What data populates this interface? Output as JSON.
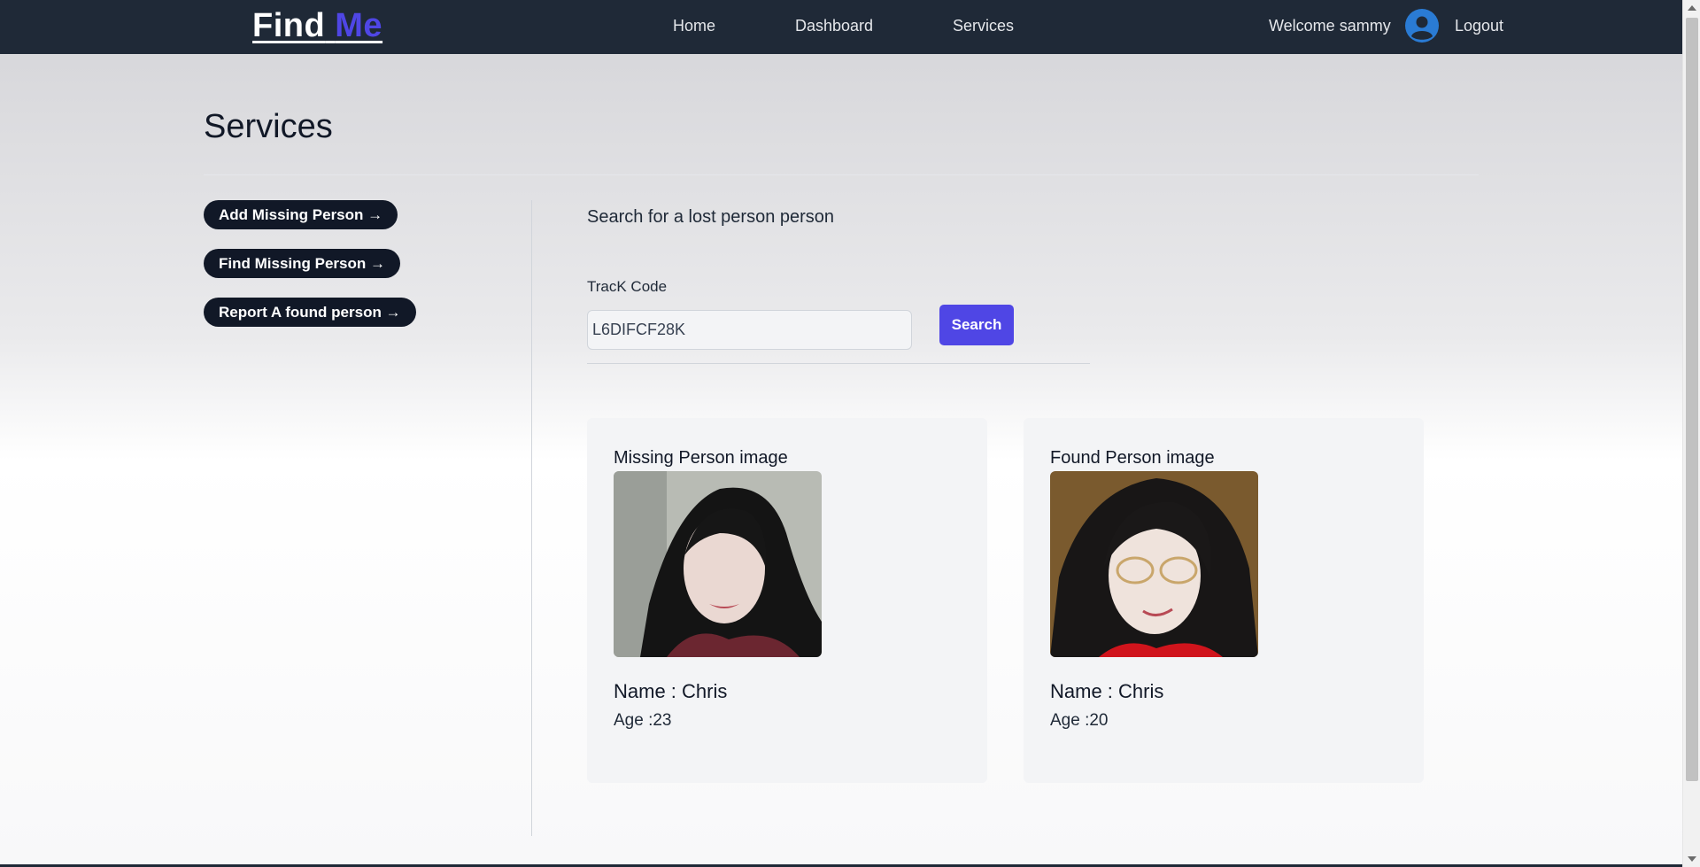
{
  "navbar": {
    "logo_part1": "Find",
    "logo_part2": "Me",
    "links": [
      "Home",
      "Dashboard",
      "Services"
    ],
    "welcome": "Welcome sammy",
    "avatar_icon": "user-circle-icon",
    "logout": "Logout"
  },
  "page": {
    "title": "Services"
  },
  "sidebar": {
    "buttons": [
      "Add Missing Person →",
      "Find Missing Person →",
      "Report A found person →"
    ]
  },
  "search": {
    "heading": "Search for a lost person person",
    "label": "TracK Code",
    "value": "L6DIFCF28K",
    "button": "Search"
  },
  "results": [
    {
      "image_label": "Missing Person image",
      "name": "Name : Chris",
      "age": "Age :23"
    },
    {
      "image_label": "Found Person image",
      "name": "Name : Chris",
      "age": "Age :20"
    }
  ],
  "colors": {
    "navbar_bg": "#1f2937",
    "accent": "#4f46e5",
    "pill_bg": "#111827",
    "card_bg": "#f3f4f6"
  }
}
